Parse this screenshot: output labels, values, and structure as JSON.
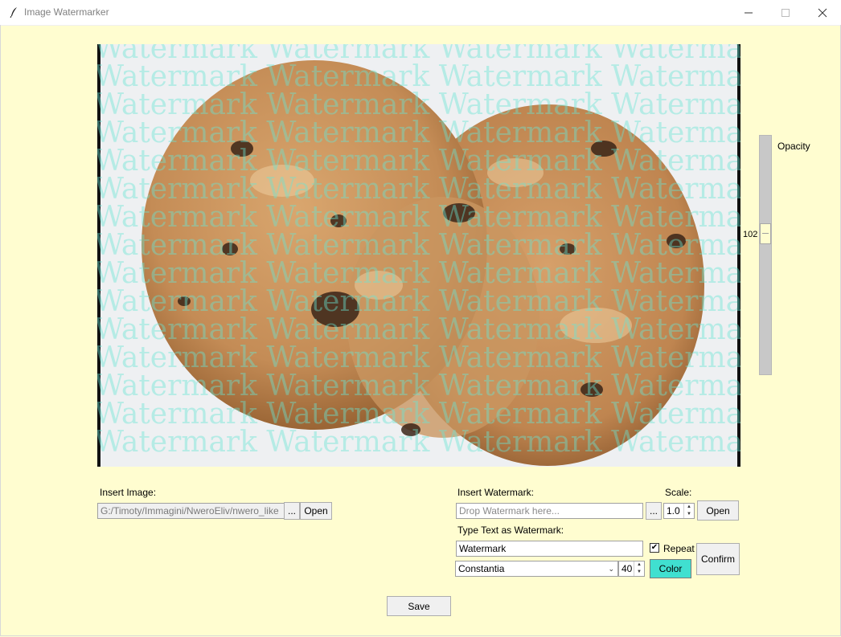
{
  "window": {
    "title": "Image Watermarker"
  },
  "watermark": {
    "text": "Watermark",
    "line_text": "Watermark Watermark Watermark Watermark",
    "line_count": 15,
    "color": "#40e0d0"
  },
  "opacity": {
    "label": "Opacity",
    "value": "102"
  },
  "image_section": {
    "label": "Insert Image:",
    "path": "G:/Timoty/Immagini/NweroEliv/nwero_like",
    "browse_label": "...",
    "open_label": "Open"
  },
  "watermark_section": {
    "label": "Insert Watermark:",
    "placeholder": "Drop Watermark here...",
    "browse_label": "...",
    "scale_label": "Scale:",
    "scale_value": "1.0",
    "open_label": "Open",
    "text_label": "Type Text as Watermark:",
    "text_value": "Watermark",
    "repeat_label": "Repeat",
    "repeat_checked": "✔",
    "font_value": "Constantia",
    "font_size": "40",
    "color_label": "Color",
    "confirm_label": "Confirm"
  },
  "save_label": "Save",
  "colors": {
    "background": "#fffdd0",
    "accent": "#40e0d0"
  }
}
